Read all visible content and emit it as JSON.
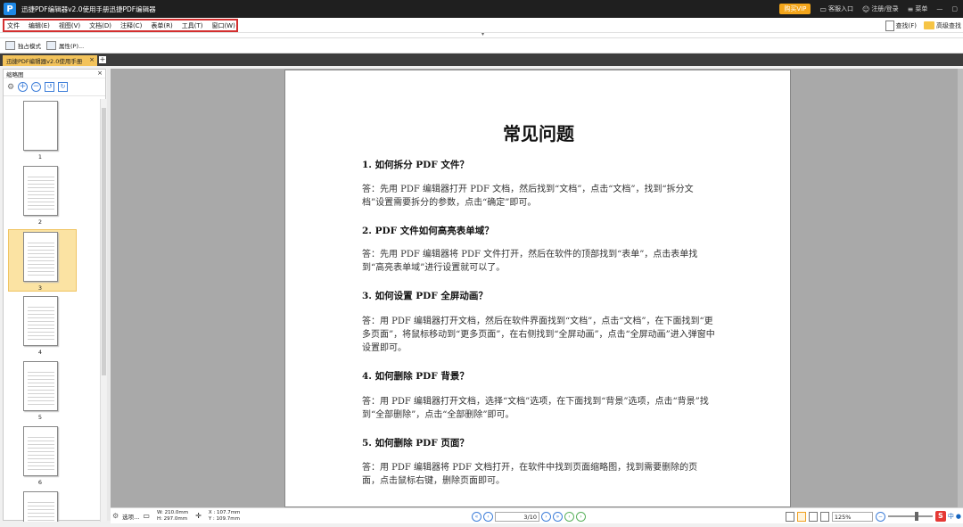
{
  "window": {
    "title": "迅捷PDF编辑器v2.0使用手册迅捷PDF编辑器",
    "logo": "P",
    "vip_label": "购买VIP",
    "service": "客服入口",
    "login": "注册/登录",
    "menu_label": "菜单",
    "minimize": "—",
    "restore": "▢"
  },
  "menubar": {
    "items": [
      "文件",
      "编辑(E)",
      "视图(V)",
      "文档(D)",
      "注释(C)",
      "表单(R)",
      "工具(T)",
      "窗口(W)"
    ],
    "find": "查找(F)",
    "advanced_find": "高级查找"
  },
  "toolbar": {
    "exclusive_mode": "独占模式",
    "properties": "属性(P)..."
  },
  "tabs": {
    "active": "迅捷PDF编辑器v2.0使用手册",
    "close": "×",
    "add": "+"
  },
  "thumbnails": {
    "title": "缩略图",
    "close": "×",
    "pages": [
      "1",
      "2",
      "3",
      "4",
      "5",
      "6"
    ],
    "selected": "3"
  },
  "document": {
    "title": "常见问题",
    "qa": [
      {
        "q": "1.  如何拆分 PDF 文件？",
        "a": "答：先用 PDF 编辑器打开 PDF 文档，然后找到“文档”，点击“文档”，找到“拆分文档”设置需要拆分的参数，点击“确定”即可。"
      },
      {
        "q": "2.  PDF 文件如何高亮表单域？",
        "a": "答：先用 PDF 编辑器将 PDF 文件打开，然后在软件的顶部找到“表单”，点击表单找到“高亮表单域”进行设置就可以了。"
      },
      {
        "q": "3.  如何设置 PDF 全屏动画？",
        "a": "答：用 PDF 编辑器打开文档，然后在软件界面找到“文档”，点击“文档”，在下面找到“更多页面”，将鼠标移动到“更多页面”，在右侧找到“全屏动画”，点击“全屏动画”进入弹窗中设置即可。"
      },
      {
        "q": "4.  如何删除 PDF 背景？",
        "a": "答：用 PDF 编辑器打开文档，选择“文档”选项，在下面找到“背景”选项，点击“背景”找到“全部删除”，点击“全部删除”即可。"
      },
      {
        "q": "5.  如何删除 PDF 页面？",
        "a": "答：用 PDF 编辑器将 PDF 文档打开，在软件中找到页面缩略图，找到需要删除的页面，点击鼠标右键，删除页面即可。"
      }
    ]
  },
  "statusbar": {
    "options": "选项...",
    "width": "W: 210.0mm",
    "height": "H: 297.0mm",
    "x": "X : 107.7mm",
    "y": "Y : 109.7mm",
    "page_value": "3/10",
    "zoom": "125%"
  },
  "ime": {
    "logo": "S",
    "lang": "中"
  },
  "colors": {
    "titlebar": "#1f1f1f",
    "vip": "#f3a51a",
    "tab_active": "#f3c35b",
    "highlight_border": "#d32f2f",
    "accent_blue": "#3f7fd9"
  }
}
